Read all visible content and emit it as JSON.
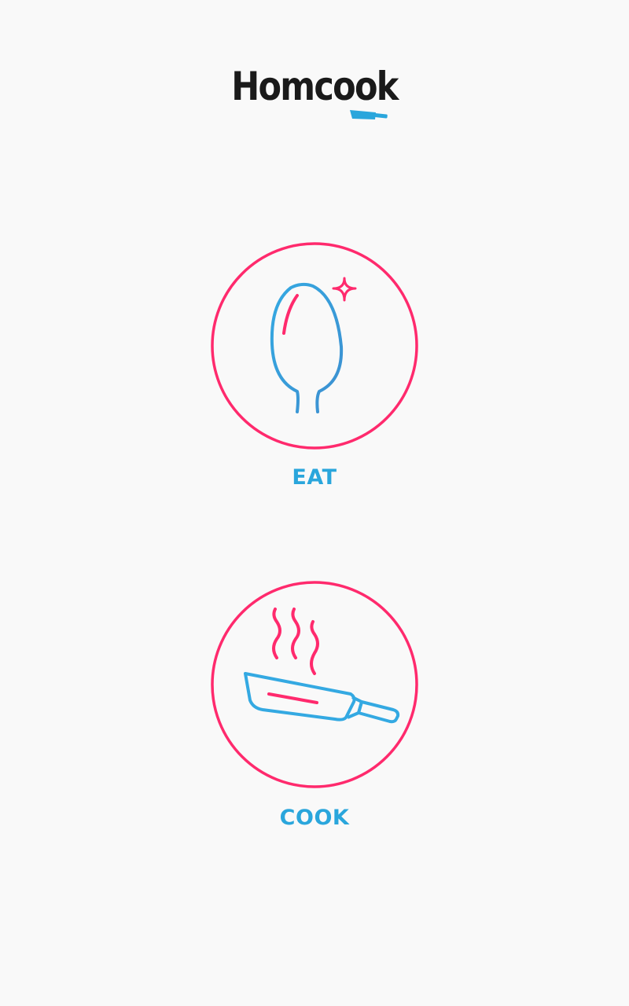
{
  "app": {
    "logo_text": "Homcook"
  },
  "choices": [
    {
      "label": "EAT",
      "icon": "spoon-icon"
    },
    {
      "label": "COOK",
      "icon": "frying-pan-icon"
    }
  ],
  "colors": {
    "background": "#f9f9f9",
    "accent_pink": "#ff2a6d",
    "accent_blue": "#2aa6dc",
    "logo_text": "#1a1a1a"
  }
}
